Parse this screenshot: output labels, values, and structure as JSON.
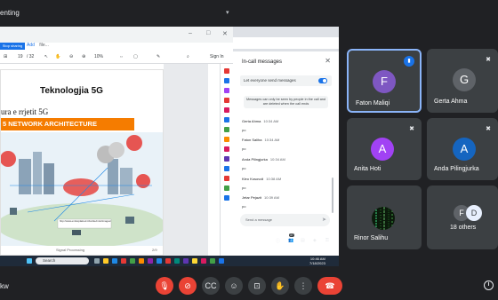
{
  "topbar": {
    "title": "enting"
  },
  "pdf": {
    "share_pill": "Stop sharing",
    "tab_label": "Add",
    "tab_file": "file...",
    "page_current": "19",
    "page_total": "/ 32",
    "zoom": "10%",
    "sign_in": "Sign In"
  },
  "slide": {
    "title": "Teknologjia 5G",
    "subtitle": "ura e rrjetit 5G",
    "banner": "5 NETWORK ARCHITECTURE",
    "footer": "Signal Processing",
    "page_number": "2/9",
    "link_text": "http://www.emfexplained.info/site/misc/images/Turnitas/1174.png"
  },
  "taskbar": {
    "search": "Search",
    "time": "10:46 AM",
    "date": "7/18/2023"
  },
  "chat": {
    "header": "In-call messages",
    "toggle_label": "Let everyone send messages",
    "notice": "Messages can only be seen by people in the call and are deleted when the call ends",
    "messages": [
      {
        "sender": "Gerta Ahma",
        "time": "10:34 AM",
        "text": "po"
      },
      {
        "sender": "Faton Saliha",
        "time": "10:34 AM",
        "text": "po"
      },
      {
        "sender": "Anda Pilingjurka",
        "time": "10:34 AM",
        "text": "po"
      },
      {
        "sender": "Kleo Kosovoli",
        "time": "10:38 AM",
        "text": "po"
      },
      {
        "sender": "Jetar Pejazit",
        "time": "10:39 AM",
        "text": "po"
      }
    ],
    "send_placeholder": "Send a message"
  },
  "mini_meet": {
    "participants_badge": "37"
  },
  "tiles": [
    {
      "name": "Faton Maliqi",
      "initial": "F",
      "color": "#7e57c2",
      "active": true
    },
    {
      "name": "Gerta Ahma",
      "initial": "G",
      "color": "#5f6368",
      "active": false
    },
    {
      "name": "Anita Hoti",
      "initial": "A",
      "color": "#a142f4",
      "active": false
    },
    {
      "name": "Anda Pilingjurka",
      "initial": "A",
      "color": "#1565c0",
      "active": false
    },
    {
      "name": "Rinor Salihu",
      "initial": "",
      "color": "#0b1a0b",
      "active": false
    },
    {
      "name": "18 others",
      "initial": "F",
      "initial2": "D",
      "color": "#5f6368",
      "active": false
    }
  ],
  "bottom": {
    "meeting_code": "kw"
  }
}
